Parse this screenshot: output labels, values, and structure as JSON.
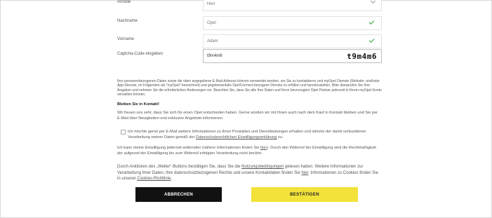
{
  "form": {
    "rows": [
      {
        "label": "Anrede",
        "value": "Herr"
      },
      {
        "label": "Nachname",
        "value": "Opel"
      },
      {
        "label": "Vorname",
        "value": "Adam"
      },
      {
        "label": "Captcha-Code eingeben",
        "value": "t9m4m6",
        "captcha_image_text": "t9m4m6"
      }
    ]
  },
  "privacy_text": "Ihre personenbezogenen Daten sowie die oben angegebene E-Mail-Adresse können verwendet werden, um Sie zu kontaktieren und myOpel Dienste (Website- und/oder App-Dienste, im Folgenden als \"myOpel\" bezeichnet) und gegebenenfalls OpelConnect-bezogene Dienste zu erfüllen und bereitzustellen. Bitte überprüfen Sie Ihre Angaben und nehmen Sie die erforderlichen Änderungen vor. Beachten Sie, dass Sie alle Ihre Daten und Ihren bevorzugten Opel Partner jederzeit in Ihrem myOpel Konto verwalten können.",
  "contact": {
    "heading": "Bleiben Sie in Kontakt!",
    "intro": "Wir freuen uns sehr, dass Sie sich für einen Opel entschieden haben. Gerne würden wir mit Ihnen auch nach dem Kauf in Kontakt bleiben und Sie per E-Mail über Neuigkeiten und exklusive Angebote informieren.",
    "consent_text": "Ich möchte gerne per E-Mail weitere Informationen zu Ihren Produkten und Dienstleistungen erhalten und stimme der damit verbundenen Verarbeitung meiner Daten gemäß der",
    "consent_link": "Datenschutzrechtlichen Einwilligungserklärung",
    "consent_end": "zu.",
    "revoke_text_1": "Ich kann meine Einwilligung jederzeit widerrufen (nähere Informationen finden Sie",
    "revoke_link": "hier",
    "revoke_text_2": "). Durch den Widerruf der Einwilligung wird die Rechtmäßigkeit der aufgrund der Einwilligung bis zum Widerruf erfolgten Verarbeitung nicht berührt."
  },
  "terms": {
    "text_1": "Durch Anklicken des „Weiter\"-Buttons bestätigen Sie, dass Sie die",
    "link_1": "Nutzungsbedingungen",
    "text_2": "gelesen haben. Weitere Informationen zur Verarbeitung Ihrer Daten, Ihre datenschutzbezogenen Rechte und unsere Kontaktdaten finden Sie",
    "link_2": "hier",
    "text_3": ". Informationen zu Cookies finden Sie in unserer",
    "link_3": "Cookies-Richtlinie",
    "text_4": "."
  },
  "buttons": {
    "abort": "ABBRECHEN",
    "confirm": "BESTÄTIGEN"
  },
  "colors": {
    "confirm_bg": "#f2e23a",
    "abort_bg": "#111111",
    "check": "#2e9e3a"
  }
}
